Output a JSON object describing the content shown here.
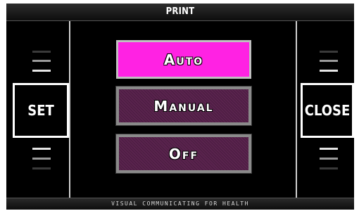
{
  "header": {
    "title": "PRINT"
  },
  "footer": {
    "text": "VISUAL COMMUNICATING FOR HEALTH"
  },
  "left_panel": {
    "label": "SET"
  },
  "right_panel": {
    "label": "CLOSE"
  },
  "options": [
    {
      "label": "Auto",
      "selected": true
    },
    {
      "label": "Manual",
      "selected": false
    },
    {
      "label": "Off",
      "selected": false
    }
  ],
  "colors": {
    "selected": "#ff22e3",
    "unselected": "#5a234e",
    "background": "#000000",
    "border": "#ffffff"
  }
}
